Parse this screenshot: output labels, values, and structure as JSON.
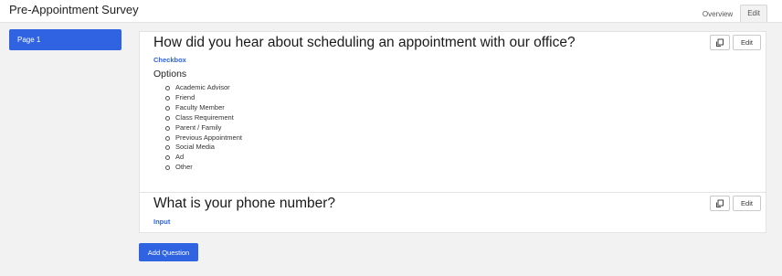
{
  "app": {
    "title": "Pre-Appointment Survey"
  },
  "tabs": [
    {
      "label": "Overview",
      "active": false
    },
    {
      "label": "Edit",
      "active": true
    }
  ],
  "sidebar": {
    "pages": [
      {
        "label": "Page 1",
        "selected": true
      }
    ]
  },
  "questions": [
    {
      "title": "How did you hear about scheduling an appointment with our office?",
      "type": "Checkbox",
      "options_label": "Options",
      "options": [
        "Academic Advisor",
        "Friend",
        "Faculty Member",
        "Class Requirement",
        "Parent / Family",
        "Previous Appointment",
        "Social Media",
        "Ad",
        "Other"
      ],
      "duplicate_icon": "duplicate-icon",
      "edit_label": "Edit"
    },
    {
      "title": "What is your phone number?",
      "type": "Input",
      "duplicate_icon": "duplicate-icon",
      "edit_label": "Edit"
    }
  ],
  "actions": {
    "add_question_label": "Add Question"
  },
  "colors": {
    "accent": "#2f63e1",
    "background": "#f2f2f2",
    "card": "#ffffff"
  }
}
